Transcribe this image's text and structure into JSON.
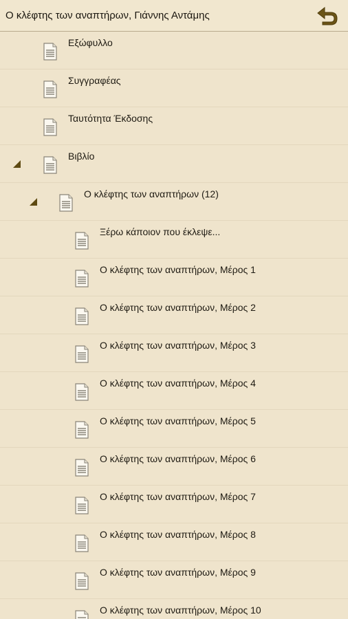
{
  "header": {
    "title": "Ο κλέφτης των αναπτήρων, Γιάννης Αντάμης",
    "back_icon": "undo-arrow-icon"
  },
  "colors": {
    "background": "#efe4cc",
    "accent": "#6b5416",
    "divider": "#e3d7bd"
  },
  "toc": {
    "items": [
      {
        "label": "Εξώφυλλο"
      },
      {
        "label": "Συγγραφέας"
      },
      {
        "label": "Ταυτότητα Έκδοσης"
      },
      {
        "label": "Βιβλίο"
      },
      {
        "label": "Ο κλέφτης των αναπτήρων (12)"
      },
      {
        "label": "Ξέρω κάποιον που έκλεψε..."
      },
      {
        "label": "Ο κλέφτης των αναπτήρων, Μέρος 1"
      },
      {
        "label": "Ο κλέφτης των αναπτήρων, Μέρος 2"
      },
      {
        "label": "Ο κλέφτης των αναπτήρων, Μέρος 3"
      },
      {
        "label": "Ο κλέφτης των αναπτήρων, Μέρος 4"
      },
      {
        "label": "Ο κλέφτης των αναπτήρων, Μέρος 5"
      },
      {
        "label": "Ο κλέφτης των αναπτήρων, Μέρος 6"
      },
      {
        "label": "Ο κλέφτης των αναπτήρων, Μέρος 7"
      },
      {
        "label": "Ο κλέφτης των αναπτήρων, Μέρος 8"
      },
      {
        "label": "Ο κλέφτης των αναπτήρων, Μέρος 9"
      },
      {
        "label": "Ο κλέφτης των αναπτήρων, Μέρος 10"
      }
    ]
  }
}
